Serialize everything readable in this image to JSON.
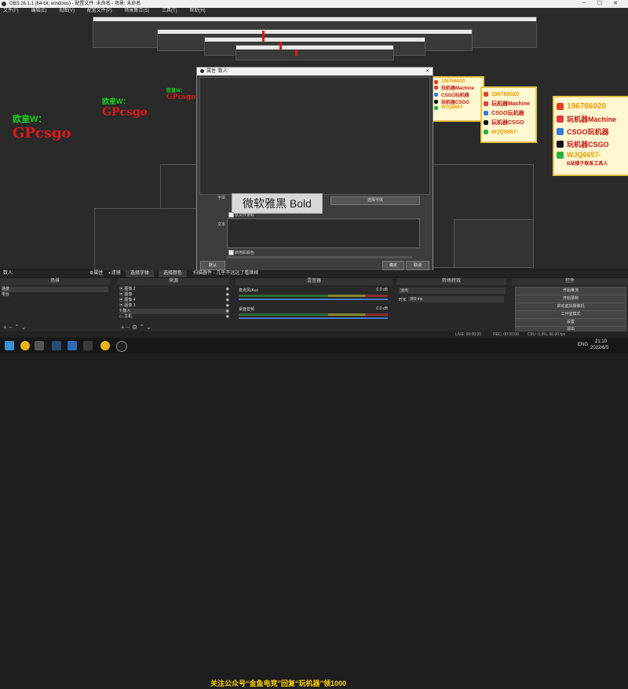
{
  "window": {
    "title": "OBS 26.1.1 (64-bit, windows) - 配置文件: 未命名 - 场景: 未命名",
    "controls": [
      "─",
      "☐",
      "✕"
    ]
  },
  "menu": [
    "文件(F)",
    "编辑(E)",
    "视图(V)",
    "配置文件(P)",
    "场景集合(S)",
    "工具(T)",
    "帮助(H)"
  ],
  "dialog": {
    "title": "属性 '数人'",
    "font_display": "微软雅黑 Bold",
    "font_label": "字体",
    "pick_font_label": "选择字体",
    "from_file_label": "从文件读取",
    "text_label": "文本",
    "text_value": "",
    "wrap_label": "启用彩颜色",
    "default_button": "默认",
    "ok_button": "确定",
    "cancel_button": "取消"
  },
  "watermarks": [
    {
      "line1": "欧皇W：",
      "line2": "GPcsgo"
    },
    {
      "line1": "欧皇W：",
      "line2": "GPcsgo"
    },
    {
      "line1": "欧皇W：",
      "line2": "GPcsgo"
    }
  ],
  "promo_panel": {
    "items": [
      {
        "icon": "weibo-icon",
        "text": "196766020",
        "color": "#e8401c"
      },
      {
        "icon": "bilibili-icon",
        "text": "玩机器Machine",
        "color": "#e03a3a"
      },
      {
        "icon": "csgo-icon",
        "text": "CSGO玩机器",
        "color": "#3a78d8"
      },
      {
        "icon": "tiktok-icon",
        "text": "玩机器CSGO",
        "color": "#111111"
      },
      {
        "icon": "wechat-icon",
        "text": "WJQ6657-",
        "color": "#2aae3e"
      }
    ],
    "sub_text": "B站搜于联系工具人"
  },
  "docks": {
    "scenes": {
      "title": "场景",
      "items": [
        "场景",
        "电台"
      ]
    },
    "sources": {
      "title": "来源",
      "items": [
        "图像 2",
        "图像",
        "图像 4",
        "图像 3",
        "数人",
        "主机"
      ]
    },
    "mixer": {
      "title": "混音器",
      "tracks": [
        {
          "name": "麦克风/Aux",
          "db": "0.0 dB"
        },
        {
          "name": "桌面音频",
          "db": "0.0 dB"
        }
      ]
    },
    "transitions": {
      "title": "转场特效",
      "type": "淡出",
      "duration_label": "时长",
      "duration": "300 ms"
    },
    "controls": {
      "title": "控件",
      "buttons": [
        "开始推流",
        "开始录制",
        "启动虚拟摄像机",
        "工作室模式",
        "设置",
        "退出"
      ]
    }
  },
  "source_bar": {
    "label": "数人",
    "props_btn": "属性",
    "filters_btn": "滤镜",
    "pick_font_btn": "选择字体",
    "pick_color_btn": "选择颜色",
    "hint": "扫描器件 - 几乎不远远了看继续"
  },
  "statusbar": {
    "live": "LIVE: 00:00:00",
    "rec": "REC: 00:00:00",
    "cpu": "CPU: 0.9%, 60.00 fps"
  },
  "taskbar": {
    "caption": "关注公众号“金鱼电竞”回复“玩机器”领1000",
    "lang": "ENG",
    "time": "21:10",
    "date": "2022/6/5"
  },
  "colors": {
    "accent_green": "#18d018",
    "accent_red": "#e01818",
    "panel_border": "#e6c44a",
    "caption": "#ffd400"
  }
}
